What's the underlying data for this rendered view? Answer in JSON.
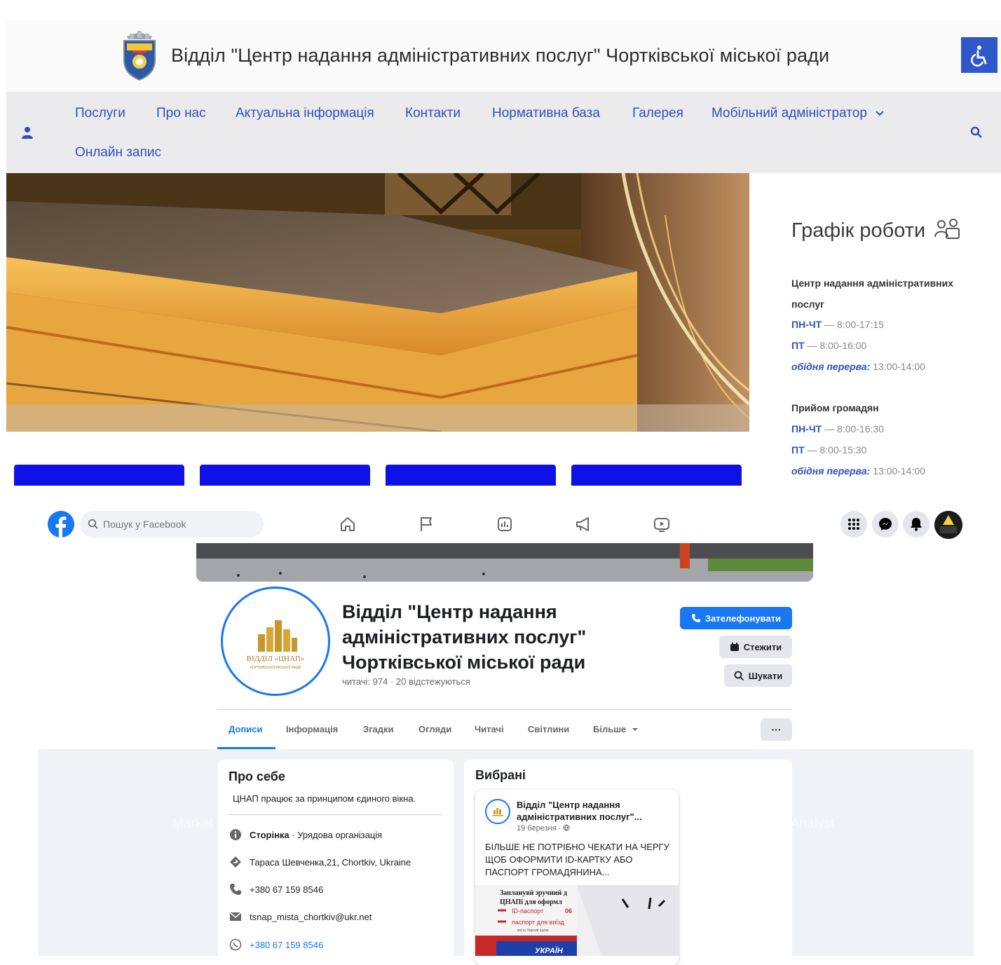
{
  "site": {
    "title": "Відділ \"Центр надання адміністративних послуг\" Чортківської міської ради",
    "nav": {
      "services": "Послуги",
      "about": "Про нас",
      "news": "Актуальна інформація",
      "contacts": "Контакти",
      "legal": "Нормативна база",
      "gallery": "Галерея",
      "mobile_admin": "Мобільний адміністратор",
      "online_booking": "Онлайн запис"
    },
    "schedule": {
      "title": "Графік роботи",
      "center_heading_1": "Центр надання адміністративних",
      "center_heading_2": "послуг",
      "center_mon_thu_label": "ПН-ЧТ",
      "center_mon_thu_hours": "8:00-17:15",
      "center_fri_label": "ПТ",
      "center_fri_hours": "8:00-16:00",
      "center_break_label": "обідня перерва:",
      "center_break_hours": "13:00-14:00",
      "citizens_heading": "Прийом громадян",
      "citizens_mon_thu_label": "ПН-ЧТ",
      "citizens_mon_thu_hours": "8:00-16:30",
      "citizens_fri_label": "ПТ",
      "citizens_fri_hours": "8:00-15:30",
      "citizens_break_label": "обідня перерва:",
      "citizens_break_hours": "13:00-14:00",
      "dash": "—"
    },
    "colors": {
      "link": "#2f50b8",
      "tile": "#0f12e6",
      "a11y": "#2e58c9"
    }
  },
  "fb": {
    "search_placeholder": "Пошук у Facebook",
    "page_name": "Відділ \"Центр надання адміністративних послуг\" Чортківської міської ради",
    "stats": "читачі: 974 · 20 відстежуються",
    "buttons": {
      "call": "Зателефонувати",
      "follow": "Стежити",
      "search": "Шукати",
      "more": "···"
    },
    "tabs": {
      "posts": "Дописи",
      "info": "Інформація",
      "mentions": "Згадки",
      "reviews": "Огляди",
      "followers": "Читачі",
      "photos": "Світлини",
      "more": "Більше"
    },
    "about": {
      "title": "Про себе",
      "text": "ЦНАП працює за принципом єдиного вікна.",
      "category_label": "Сторінка",
      "category_value": " · Урядова організація",
      "address": "Тараса Шевченка,21, Chortkiv, Ukraine",
      "phone": "+380 67 159 8546",
      "email": "tsnap_mista_chortkiv@ukr.net",
      "whatsapp": "+380 67 159 8546"
    },
    "featured": {
      "title": "Вибрані",
      "post_author": "Відділ \"Центр надання адміністративних послуг\"...",
      "post_date": "19 березня · ",
      "post_text": "БІЛЬШЕ НЕ ПОТРІБНО ЧЕКАТИ НА ЧЕРГУ ЩОБ ОФОРМИТИ ID-КАРТКУ АБО ПАСПОРТ ГРОМАДЯНИНА...",
      "img_line1": "Запланувй зручний д",
      "img_line2": "ЦНАПі для оформл",
      "img_line3": "ID-паспорт",
      "img_line3b": "06",
      "img_line4": "паспорт для виїзд",
      "img_line5": "місто Чортків шуми",
      "img_line6": "УКРАЇН"
    },
    "logo_text_1": "ВІДДІЛ «ЦНАП»",
    "logo_text_2": "ЧОРТКІВСЬКОЇ МІСЬКОЇ РАДИ",
    "watermark_1": "Market",
    "watermark_2": "Analyst",
    "colors": {
      "brand": "#1877f2",
      "bg": "#f0f2f5"
    }
  }
}
